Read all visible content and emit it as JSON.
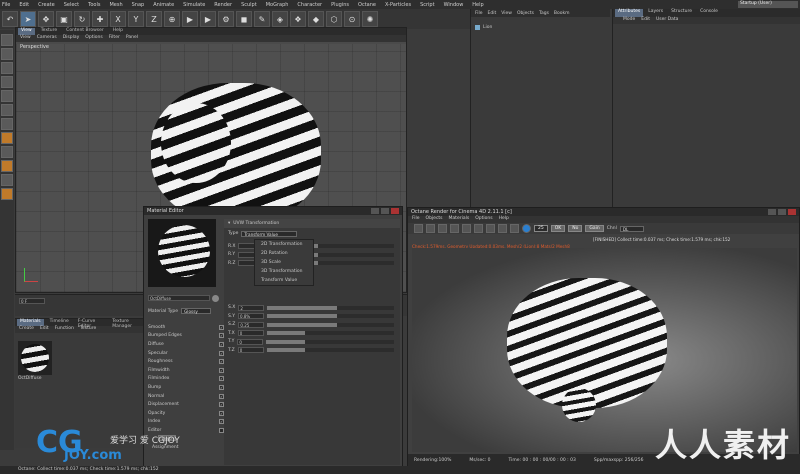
{
  "menubar": [
    "File",
    "Edit",
    "Create",
    "Select",
    "Tools",
    "Mesh",
    "Snap",
    "Animate",
    "Simulate",
    "Render",
    "Sculpt",
    "MoGraph",
    "Character",
    "Plugins",
    "Octane",
    "X-Particles",
    "Script",
    "Window",
    "Help"
  ],
  "layout_label": "Startup (User)",
  "toolbar": {
    "axes": [
      "X",
      "Y",
      "Z"
    ]
  },
  "viewport": {
    "tabs": [
      "View",
      "Texture",
      "Content Browser",
      "Help"
    ],
    "menu": [
      "View",
      "Cameras",
      "Display",
      "Options",
      "Filter",
      "Panel"
    ],
    "label": "Perspective"
  },
  "object_manager": {
    "menu": [
      "File",
      "Edit",
      "View",
      "Objects",
      "Tags",
      "Bookm"
    ],
    "item": "Lion"
  },
  "attributes": {
    "tabs": [
      "Attributes",
      "Layers",
      "Structure",
      "Console"
    ],
    "menu": [
      "Mode",
      "Edit",
      "User Data"
    ]
  },
  "timeline": {
    "frame": "0 F"
  },
  "material_manager": {
    "tabs": [
      "Materials",
      "Timeline",
      "F-Curve Editor",
      "Texture Manager"
    ],
    "menu": [
      "Create",
      "Edit",
      "Function",
      "Texture"
    ],
    "material_name": "OctDiffuse"
  },
  "material_editor": {
    "title": "Material Editor",
    "name": "OctDiffuse",
    "material_type_label": "Material Type",
    "material_type_value": "Glossy",
    "channels": [
      {
        "label": "Smooth",
        "checked": true
      },
      {
        "label": "Bumped Edges",
        "checked": true
      },
      {
        "label": "Diffuse",
        "checked": true
      },
      {
        "label": "Specular",
        "checked": true
      },
      {
        "label": "Roughness",
        "checked": true
      },
      {
        "label": "Filmwidth",
        "checked": true
      },
      {
        "label": "Filmindex",
        "checked": true
      },
      {
        "label": "Bump",
        "checked": true
      },
      {
        "label": "Normal",
        "checked": true
      },
      {
        "label": "Displacement",
        "checked": true
      },
      {
        "label": "Opacity",
        "checked": true
      },
      {
        "label": "Index",
        "checked": true
      },
      {
        "label": "Editor",
        "checked": false
      }
    ],
    "help_label": "Help",
    "assignment_label": "Assignment",
    "section_title": "UVW Transformation",
    "type_label": "Type",
    "type_value": "Transform Value",
    "type_options": [
      "2D Transformation",
      "2D Rotation",
      "3D Scale",
      "3D Transformation",
      "Transform Value"
    ],
    "params": [
      {
        "label": "R.X",
        "value": ""
      },
      {
        "label": "R.Y",
        "value": ""
      },
      {
        "label": "R.Z",
        "value": ""
      },
      {
        "label": "S.X",
        "value": "2"
      },
      {
        "label": "S.Y",
        "value": "0.8%"
      },
      {
        "label": "S.Z",
        "value": "0.25"
      },
      {
        "label": "T.X",
        "value": "0"
      },
      {
        "label": "T.Y",
        "value": "0"
      },
      {
        "label": "T.Z",
        "value": "0"
      }
    ]
  },
  "octane": {
    "title": "Octane Render for Cinema 4D 2.11.1 [c]",
    "menu": [
      "File",
      "Objects",
      "Materials",
      "Options",
      "Help"
    ],
    "pills": [
      "25",
      "OK",
      "No",
      "Gain"
    ],
    "chnl_label": "Chnl",
    "chnl_value": "DL",
    "finished": "[FINISHED] Collect time:0.037 ms; Check time:1.579 ms; chk:152",
    "error_line": "Check:1.579ms, Geometry Updated:0.03ms, Mesh/2 (Lion):8 Mats/2 Mesh8",
    "status": [
      "Rendering:100%",
      "Ms/sec: 0",
      "Time: 00 : 00 : 00/00 : 00 : 03",
      "Spp/maxspp: 256/256"
    ]
  },
  "bottom_status": "Octane: Collect time:0.037 ms; Check time:1.579 ms; chk:152",
  "watermarks": {
    "cg": "CG",
    "joy": "JOY.com",
    "cn": "爱学习 爱 CGJOY",
    "rr": "人人素材"
  },
  "colors": {
    "accent": "#5a6b82",
    "error": "#e05a2a",
    "watermark_blue": "#2a8ad8"
  }
}
